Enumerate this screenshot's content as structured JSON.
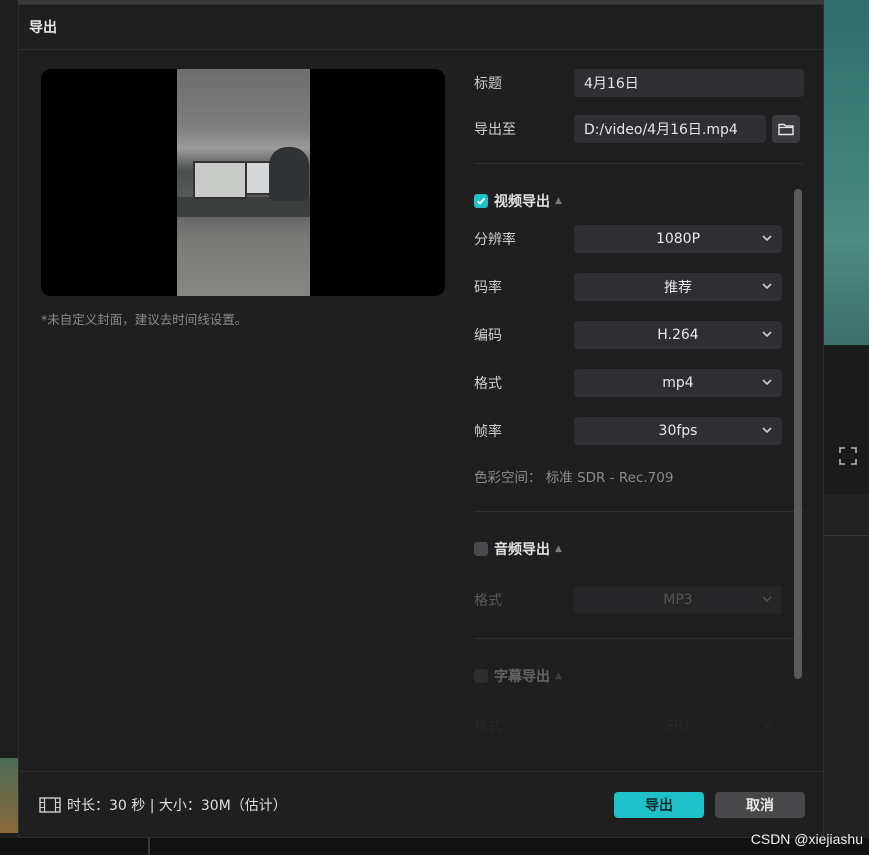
{
  "dialog": {
    "title": "导出"
  },
  "preview": {
    "cover_note": "*未自定义封面，建议去时间线设置。"
  },
  "form": {
    "title_label": "标题",
    "title_value": "4月16日",
    "export_to_label": "导出至",
    "export_path": "D:/video/4月16日.mp4"
  },
  "video_export": {
    "label": "视频导出",
    "checked": true,
    "fields": [
      {
        "label": "分辨率",
        "value": "1080P"
      },
      {
        "label": "码率",
        "value": "推荐"
      },
      {
        "label": "编码",
        "value": "H.264"
      },
      {
        "label": "格式",
        "value": "mp4"
      },
      {
        "label": "帧率",
        "value": "30fps"
      }
    ],
    "color_space": "色彩空间：  标准 SDR - Rec.709"
  },
  "audio_export": {
    "label": "音频导出",
    "checked": false,
    "format_label": "格式",
    "format_value": "MP3"
  },
  "subtitle_export": {
    "label": "字幕导出",
    "format_label": "格式",
    "format_value": "SRT"
  },
  "footer": {
    "info": "时长：30 秒 | 大小：30M（估计）",
    "export_label": "导出",
    "cancel_label": "取消"
  },
  "watermark": "CSDN @xiejiashu",
  "colors": {
    "accent": "#1fc1c9",
    "dialog_bg": "#1f1f20",
    "input_bg": "#2f2f33"
  }
}
